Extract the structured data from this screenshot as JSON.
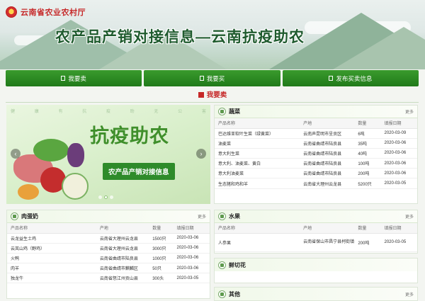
{
  "header": {
    "org_name": "云南省农业农村厅",
    "title": "农产品产销对接信息—云南抗疫助农"
  },
  "nav": [
    {
      "label": "我要卖"
    },
    {
      "label": "我要买"
    },
    {
      "label": "发布买卖信息"
    }
  ],
  "section_title": "我要卖",
  "carousel": {
    "faint_text": [
      "健",
      "康",
      "有",
      "抗",
      "疫",
      "助",
      "无",
      "公",
      "害"
    ],
    "title": "抗疫助农",
    "subtitle": "农产品产销对接信息"
  },
  "columns": {
    "name": "产品名称",
    "origin": "产地",
    "qty": "数量",
    "date": "填报日期"
  },
  "more_label": "更多",
  "panels": {
    "vegetables": {
      "title": "蔬菜",
      "rows": [
        {
          "name": "巴达维亚软叶生菜（绿黄菜）",
          "origin": "云南声昆明市呈贡区",
          "qty": "6吨",
          "date": "2020-03-09"
        },
        {
          "name": "油麦菜",
          "origin": "云南省曲靖市陆良县",
          "qty": "35吨",
          "date": "2020-03-06"
        },
        {
          "name": "意大利生菜",
          "origin": "云南省曲靖市陆良县",
          "qty": "40吨",
          "date": "2020-03-06"
        },
        {
          "name": "意大利、油麦菜、黄白",
          "origin": "云南省曲靖市陆良县",
          "qty": "100吨",
          "date": "2020-03-06"
        },
        {
          "name": "意大利油麦菜",
          "origin": "云南省曲靖市陆良县",
          "qty": "200吨",
          "date": "2020-03-06"
        },
        {
          "name": "生态猪和鸡和羊",
          "origin": "云南省大理州云龙县",
          "qty": "5200只",
          "date": "2020-03-05"
        }
      ]
    },
    "meat": {
      "title": "肉蛋奶",
      "rows": [
        {
          "name": "云龙益生土鸡",
          "origin": "云南省大理州云龙县",
          "qty": "1500只",
          "date": "2020-03-06"
        },
        {
          "name": "云岚山鸡（野鸡）",
          "origin": "云南省大理州云龙县",
          "qty": "3000只",
          "date": "2020-03-06"
        },
        {
          "name": "火鸭",
          "origin": "云南省曲靖市陆良县",
          "qty": "1000只",
          "date": "2020-03-06"
        },
        {
          "name": "肉羊",
          "origin": "云南省曲靖市麒麟区",
          "qty": "50只",
          "date": "2020-03-06"
        },
        {
          "name": "独龙牛",
          "origin": "云南省怒江州贡山县",
          "qty": "300头",
          "date": "2020-03-05"
        }
      ]
    },
    "fruit": {
      "title": "水果",
      "rows": [
        {
          "name": "人参果",
          "origin": "云南省保山市昌宁县柯街镇",
          "qty": "200吨",
          "date": "2020-03-05"
        }
      ]
    },
    "flowers": {
      "title": "鲜切花"
    },
    "others": {
      "title": "其他"
    }
  },
  "colors": {
    "brand_green": "#207a1a",
    "accent_red": "#c62828"
  }
}
